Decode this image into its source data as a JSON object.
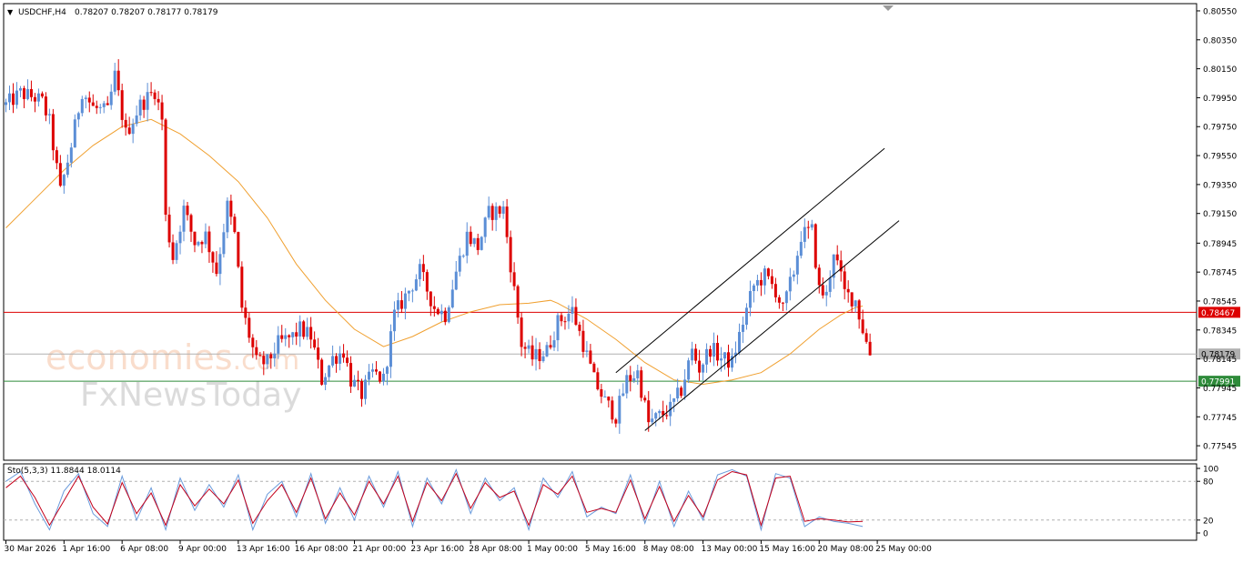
{
  "header": {
    "symbol_label": "USDCHF,H4",
    "ohlc_text": "0.78207 0.78207 0.78177 0.78179",
    "menu_glyph": "▼"
  },
  "watermark": {
    "line1": "economies",
    "line1_suffix": ".com",
    "line2": "FxNewsToday"
  },
  "indicator": {
    "label": "Sto(5,3,3) 11.8844 18.0114",
    "levels": [
      "100",
      "80",
      "20",
      "0"
    ],
    "level_values": [
      100,
      80,
      20,
      0
    ]
  },
  "colors": {
    "bull": "#5b8ed6",
    "bear": "#dd0000",
    "ma": "#f0a030",
    "channel": "#000000",
    "resistance_line": "#dd0000",
    "support_line": "#2e8b3a",
    "current_line": "#b0b0b0",
    "stoch_main": "#6a9bdc",
    "stoch_signal": "#c4001a"
  },
  "chart_data": {
    "type": "candlestick",
    "symbol": "USDCHF",
    "timeframe": "H4",
    "ylim": [
      0.77445,
      0.806
    ],
    "price_ticks": [
      "0.80550",
      "0.80350",
      "0.80150",
      "0.79950",
      "0.79750",
      "0.79550",
      "0.79350",
      "0.79150",
      "0.78945",
      "0.78745",
      "0.78545",
      "0.78345",
      "0.78145",
      "0.77945",
      "0.77745",
      "0.77545"
    ],
    "price_tick_values": [
      0.8055,
      0.8035,
      0.8015,
      0.7995,
      0.7975,
      0.7955,
      0.7935,
      0.7915,
      0.78945,
      0.78745,
      0.78545,
      0.78345,
      0.78145,
      0.77945,
      0.77745,
      0.77545
    ],
    "x_labels": [
      "30 Mar 2026",
      "1 Apr 16:00",
      "6 Apr 08:00",
      "9 Apr 00:00",
      "13 Apr 16:00",
      "16 Apr 08:00",
      "21 Apr 00:00",
      "23 Apr 16:00",
      "28 Apr 08:00",
      "1 May 00:00",
      "5 May 16:00",
      "8 May 08:00",
      "13 May 00:00",
      "15 May 16:00",
      "20 May 08:00",
      "25 May 00:00"
    ],
    "x_label_bars": [
      0,
      16,
      32,
      48,
      64,
      80,
      96,
      112,
      128,
      144,
      160,
      176,
      192,
      208,
      224,
      240
    ],
    "horizontal_levels": [
      {
        "label": "0.78467",
        "value": 0.78467,
        "color": "#dd0000"
      },
      {
        "label": "0.78179",
        "value": 0.78179,
        "color": "#b0b0b0"
      },
      {
        "label": "0.77991",
        "value": 0.77991,
        "color": "#2e8b3a"
      }
    ],
    "channel": {
      "lower": [
        [
          176,
          0.7765
        ],
        [
          246,
          0.791
        ]
      ],
      "upper": [
        [
          168,
          0.7805
        ],
        [
          242,
          0.796
        ]
      ]
    },
    "moving_average": [
      [
        0,
        0.7905
      ],
      [
        8,
        0.7925
      ],
      [
        16,
        0.7945
      ],
      [
        24,
        0.7962
      ],
      [
        32,
        0.7975
      ],
      [
        40,
        0.798
      ],
      [
        48,
        0.797
      ],
      [
        56,
        0.7955
      ],
      [
        64,
        0.7937
      ],
      [
        72,
        0.7912
      ],
      [
        80,
        0.788
      ],
      [
        88,
        0.7855
      ],
      [
        96,
        0.7835
      ],
      [
        104,
        0.7823
      ],
      [
        112,
        0.783
      ],
      [
        120,
        0.784
      ],
      [
        128,
        0.7847
      ],
      [
        136,
        0.7852
      ],
      [
        144,
        0.7853
      ],
      [
        150,
        0.7855
      ],
      [
        152,
        0.7853
      ],
      [
        160,
        0.7842
      ],
      [
        168,
        0.7828
      ],
      [
        176,
        0.7812
      ],
      [
        184,
        0.78
      ],
      [
        192,
        0.7797
      ],
      [
        200,
        0.78
      ],
      [
        208,
        0.7805
      ],
      [
        216,
        0.7818
      ],
      [
        224,
        0.7835
      ],
      [
        230,
        0.7845
      ],
      [
        234,
        0.785
      ],
      [
        236,
        0.7851
      ]
    ],
    "close_path": [
      [
        0,
        0.799
      ],
      [
        4,
        0.7998
      ],
      [
        8,
        0.7995
      ],
      [
        10,
        0.7992
      ],
      [
        12,
        0.7978
      ],
      [
        15,
        0.793
      ],
      [
        18,
        0.7962
      ],
      [
        21,
        0.8
      ],
      [
        24,
        0.7988
      ],
      [
        28,
        0.7985
      ],
      [
        30,
        0.801
      ],
      [
        33,
        0.797
      ],
      [
        37,
        0.799
      ],
      [
        41,
        0.8
      ],
      [
        43,
        0.798
      ],
      [
        44,
        0.7912
      ],
      [
        46,
        0.7885
      ],
      [
        49,
        0.7918
      ],
      [
        52,
        0.7895
      ],
      [
        55,
        0.79
      ],
      [
        58,
        0.7875
      ],
      [
        61,
        0.792
      ],
      [
        63,
        0.79
      ],
      [
        65,
        0.785
      ],
      [
        69,
        0.7812
      ],
      [
        72,
        0.7812
      ],
      [
        75,
        0.7825
      ],
      [
        79,
        0.783
      ],
      [
        81,
        0.7835
      ],
      [
        84,
        0.783
      ],
      [
        87,
        0.78
      ],
      [
        90,
        0.7815
      ],
      [
        93,
        0.782
      ],
      [
        95,
        0.78
      ],
      [
        98,
        0.779
      ],
      [
        101,
        0.7805
      ],
      [
        104,
        0.78
      ],
      [
        107,
        0.7845
      ],
      [
        111,
        0.7862
      ],
      [
        114,
        0.7875
      ],
      [
        118,
        0.785
      ],
      [
        121,
        0.7845
      ],
      [
        124,
        0.7875
      ],
      [
        127,
        0.79
      ],
      [
        130,
        0.7892
      ],
      [
        133,
        0.7915
      ],
      [
        137,
        0.7918
      ],
      [
        139,
        0.788
      ],
      [
        142,
        0.7825
      ],
      [
        145,
        0.7815
      ],
      [
        149,
        0.782
      ],
      [
        152,
        0.784
      ],
      [
        156,
        0.7848
      ],
      [
        159,
        0.7825
      ],
      [
        162,
        0.78
      ],
      [
        165,
        0.7785
      ],
      [
        168,
        0.7775
      ],
      [
        171,
        0.78
      ],
      [
        174,
        0.7805
      ],
      [
        177,
        0.777
      ],
      [
        180,
        0.7775
      ],
      [
        183,
        0.778
      ],
      [
        186,
        0.7793
      ],
      [
        189,
        0.782
      ],
      [
        191,
        0.7808
      ],
      [
        194,
        0.7822
      ],
      [
        197,
        0.7815
      ],
      [
        200,
        0.7812
      ],
      [
        203,
        0.784
      ],
      [
        206,
        0.7865
      ],
      [
        209,
        0.7872
      ],
      [
        212,
        0.7862
      ],
      [
        214,
        0.7848
      ],
      [
        217,
        0.7875
      ],
      [
        219,
        0.79
      ],
      [
        222,
        0.7903
      ],
      [
        224,
        0.7862
      ],
      [
        226,
        0.7858
      ],
      [
        228,
        0.789
      ],
      [
        231,
        0.786
      ],
      [
        234,
        0.7855
      ],
      [
        236,
        0.7835
      ],
      [
        238,
        0.7817
      ]
    ],
    "stochastic_main": [
      [
        0,
        80
      ],
      [
        4,
        95
      ],
      [
        8,
        45
      ],
      [
        12,
        5
      ],
      [
        16,
        65
      ],
      [
        20,
        92
      ],
      [
        24,
        30
      ],
      [
        28,
        10
      ],
      [
        32,
        88
      ],
      [
        36,
        20
      ],
      [
        40,
        70
      ],
      [
        44,
        5
      ],
      [
        48,
        85
      ],
      [
        52,
        35
      ],
      [
        56,
        75
      ],
      [
        60,
        40
      ],
      [
        64,
        90
      ],
      [
        68,
        5
      ],
      [
        72,
        60
      ],
      [
        76,
        80
      ],
      [
        80,
        25
      ],
      [
        84,
        92
      ],
      [
        88,
        15
      ],
      [
        92,
        70
      ],
      [
        96,
        20
      ],
      [
        100,
        88
      ],
      [
        104,
        40
      ],
      [
        108,
        95
      ],
      [
        112,
        10
      ],
      [
        116,
        85
      ],
      [
        120,
        45
      ],
      [
        124,
        98
      ],
      [
        128,
        30
      ],
      [
        132,
        85
      ],
      [
        136,
        50
      ],
      [
        140,
        70
      ],
      [
        144,
        5
      ],
      [
        148,
        85
      ],
      [
        152,
        55
      ],
      [
        156,
        95
      ],
      [
        160,
        25
      ],
      [
        164,
        40
      ],
      [
        168,
        30
      ],
      [
        172,
        90
      ],
      [
        176,
        15
      ],
      [
        180,
        80
      ],
      [
        184,
        10
      ],
      [
        188,
        65
      ],
      [
        192,
        20
      ],
      [
        196,
        90
      ],
      [
        200,
        98
      ],
      [
        204,
        88
      ],
      [
        208,
        5
      ],
      [
        212,
        92
      ],
      [
        216,
        85
      ],
      [
        220,
        10
      ],
      [
        224,
        25
      ],
      [
        228,
        18
      ],
      [
        232,
        15
      ],
      [
        236,
        10
      ]
    ],
    "stochastic_signal": [
      [
        0,
        70
      ],
      [
        4,
        88
      ],
      [
        8,
        55
      ],
      [
        12,
        12
      ],
      [
        16,
        50
      ],
      [
        20,
        88
      ],
      [
        24,
        40
      ],
      [
        28,
        14
      ],
      [
        32,
        78
      ],
      [
        36,
        30
      ],
      [
        40,
        62
      ],
      [
        44,
        12
      ],
      [
        48,
        75
      ],
      [
        52,
        42
      ],
      [
        56,
        68
      ],
      [
        60,
        45
      ],
      [
        64,
        82
      ],
      [
        68,
        15
      ],
      [
        72,
        50
      ],
      [
        76,
        75
      ],
      [
        80,
        32
      ],
      [
        84,
        85
      ],
      [
        88,
        22
      ],
      [
        92,
        62
      ],
      [
        96,
        28
      ],
      [
        100,
        80
      ],
      [
        104,
        45
      ],
      [
        108,
        88
      ],
      [
        112,
        18
      ],
      [
        116,
        78
      ],
      [
        120,
        50
      ],
      [
        124,
        92
      ],
      [
        128,
        38
      ],
      [
        132,
        78
      ],
      [
        136,
        55
      ],
      [
        140,
        65
      ],
      [
        144,
        12
      ],
      [
        148,
        75
      ],
      [
        152,
        60
      ],
      [
        156,
        88
      ],
      [
        160,
        32
      ],
      [
        164,
        38
      ],
      [
        168,
        32
      ],
      [
        172,
        82
      ],
      [
        176,
        22
      ],
      [
        180,
        72
      ],
      [
        184,
        18
      ],
      [
        188,
        58
      ],
      [
        192,
        25
      ],
      [
        196,
        82
      ],
      [
        200,
        95
      ],
      [
        204,
        90
      ],
      [
        208,
        12
      ],
      [
        212,
        85
      ],
      [
        216,
        88
      ],
      [
        220,
        18
      ],
      [
        224,
        22
      ],
      [
        228,
        20
      ],
      [
        232,
        17
      ],
      [
        236,
        18
      ]
    ]
  }
}
